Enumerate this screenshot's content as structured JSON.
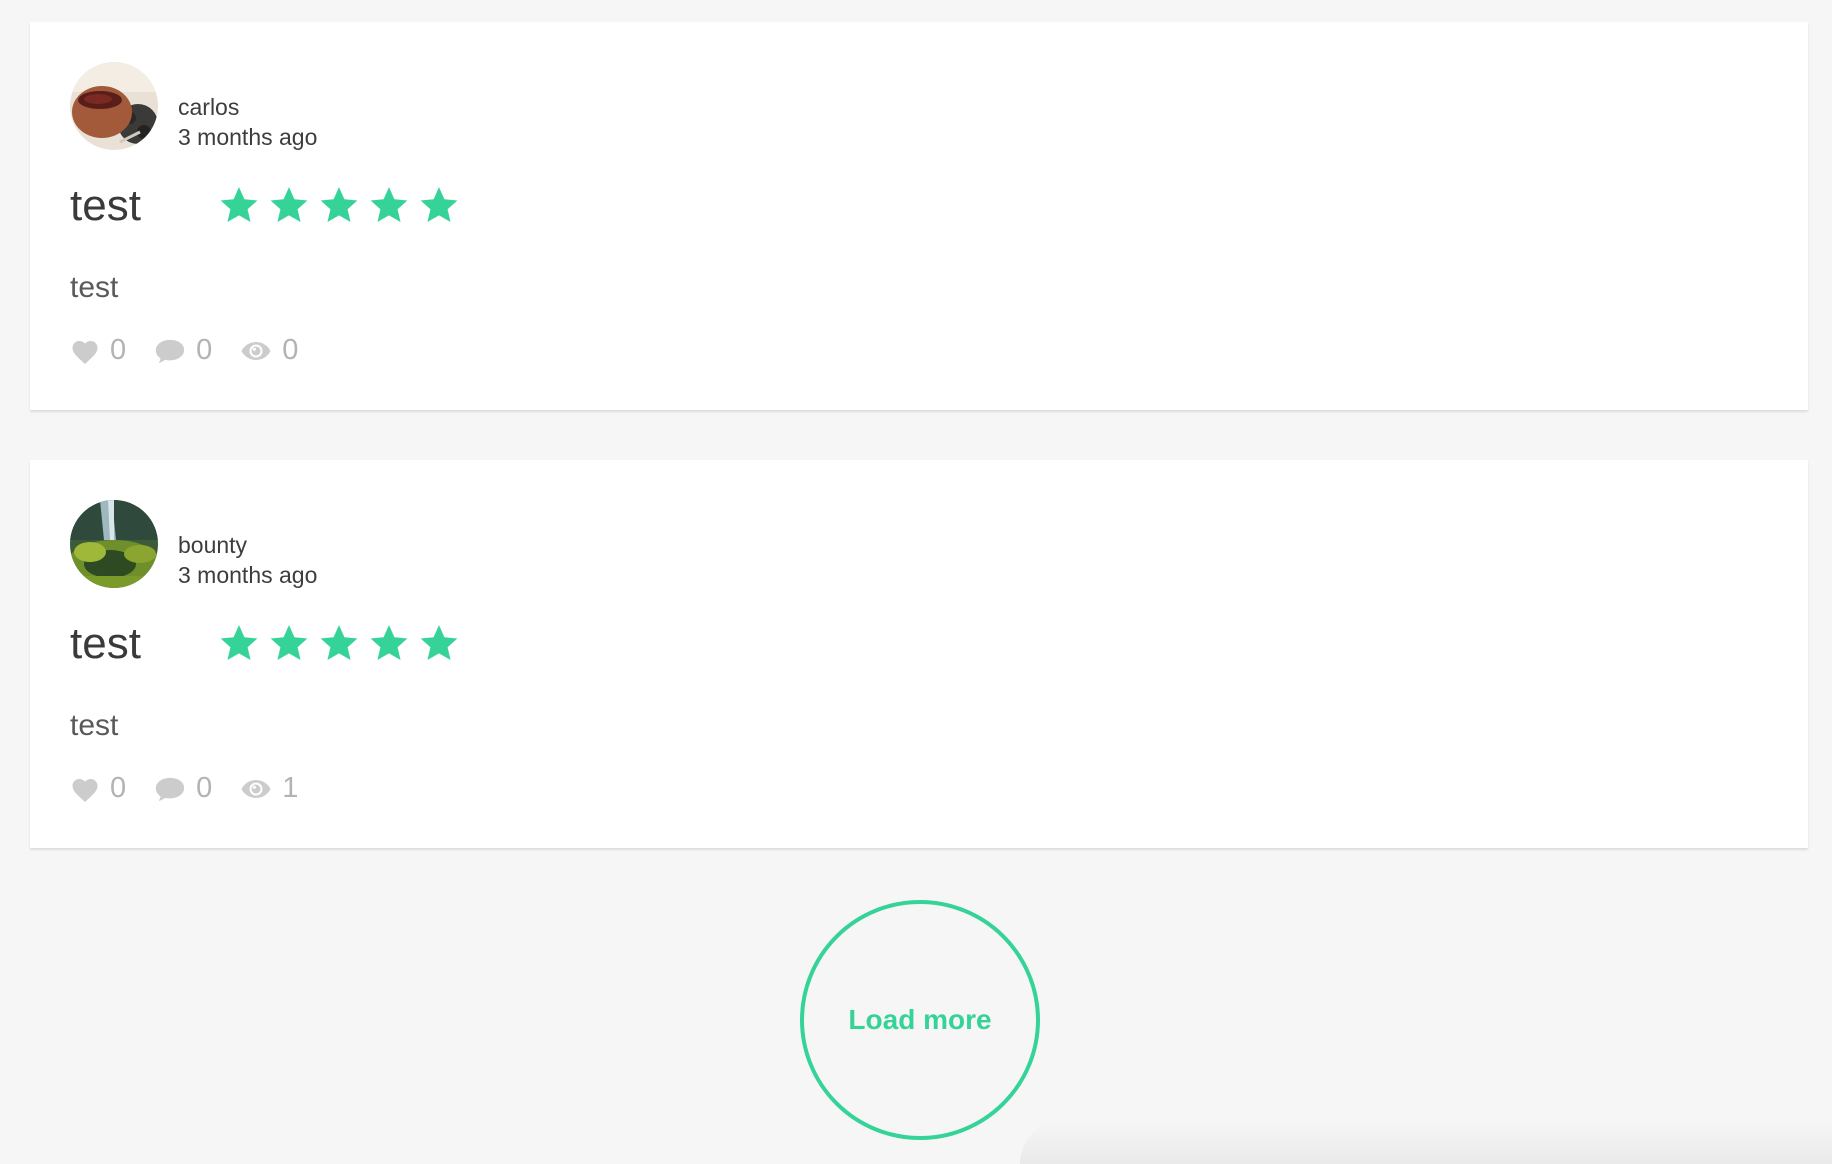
{
  "reviews": [
    {
      "author": "carlos",
      "time": "3 months ago",
      "title": "test",
      "rating": 5,
      "rating_max": 5,
      "body": "test",
      "likes": "0",
      "comments": "0",
      "views": "0",
      "avatar_icon": "avatar-photo-tea-cup"
    },
    {
      "author": "bounty",
      "time": "3 months ago",
      "title": "test",
      "rating": 5,
      "rating_max": 5,
      "body": "test",
      "likes": "0",
      "comments": "0",
      "views": "1",
      "avatar_icon": "avatar-photo-landscape"
    }
  ],
  "load_more_label": "Load more",
  "colors": {
    "accent": "#36d399",
    "icon_gray": "#cccccc",
    "background": "#f6f6f6"
  },
  "icons": {
    "like": "heart-icon",
    "comment": "comment-icon",
    "view": "eye-icon",
    "star": "star-icon"
  }
}
